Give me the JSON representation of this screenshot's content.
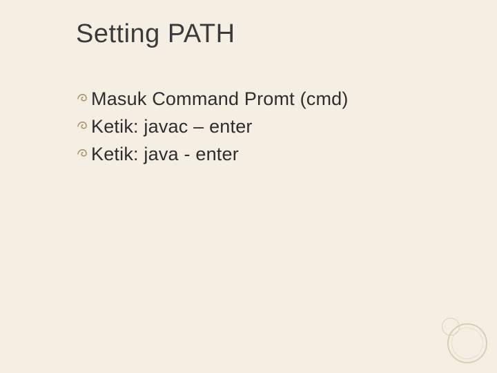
{
  "slide": {
    "title": "Setting PATH",
    "bullets": [
      "Masuk Command Promt (cmd)",
      "Ketik: javac – enter",
      "Ketik: java - enter"
    ]
  },
  "colors": {
    "background": "#f5efe3",
    "text": "#2d2d2d",
    "title": "#3a3a3a",
    "accent": "#a88b5f"
  }
}
